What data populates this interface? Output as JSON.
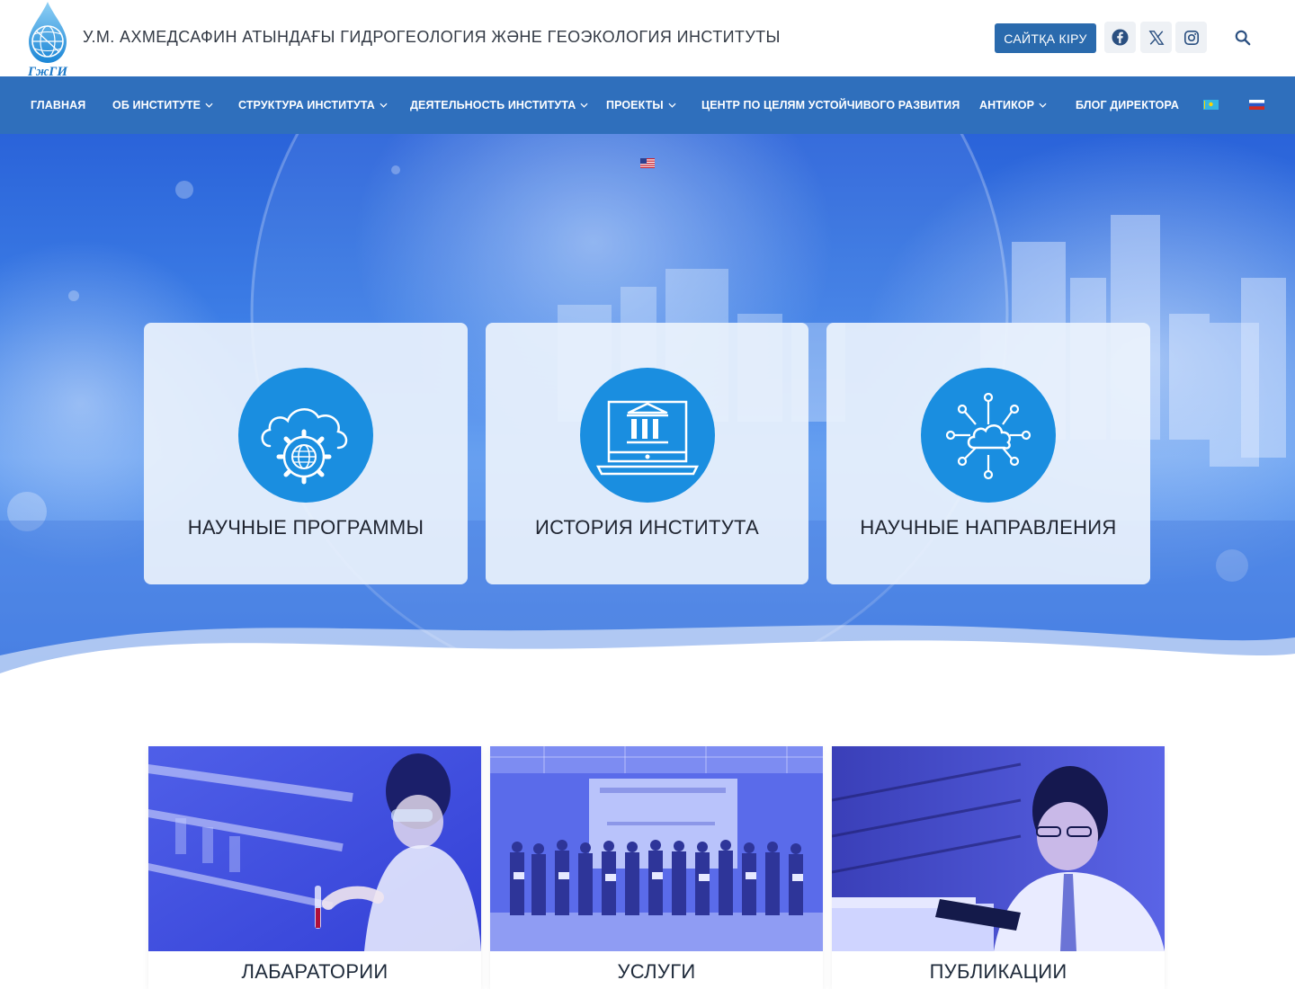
{
  "header": {
    "logo_text": "ГжГИ",
    "site_title": "У.М. АХМЕДСАФИН АТЫНДАҒЫ ГИДРОГЕОЛОГИЯ ЖӘНЕ ГЕОЭКОЛОГИЯ ИНСТИТУТЫ",
    "login_label": "САЙТҚА КІРУ",
    "social": [
      {
        "name": "facebook",
        "icon": "facebook-icon"
      },
      {
        "name": "x",
        "icon": "x-icon"
      },
      {
        "name": "instagram",
        "icon": "instagram-icon"
      }
    ],
    "search_icon": "search-icon"
  },
  "nav": {
    "items": [
      {
        "label": "ГЛАВНАЯ",
        "dropdown": false
      },
      {
        "label": "ОБ ИНСТИТУТЕ",
        "dropdown": true
      },
      {
        "label": "СТРУКТУРА ИНСТИТУТА",
        "dropdown": true
      },
      {
        "label": "ДЕЯТЕЛЬНОСТЬ ИНСТИТУТА",
        "dropdown": true
      },
      {
        "label": "ПРОЕКТЫ",
        "dropdown": true
      },
      {
        "label": "ЦЕНТР ПО ЦЕЛЯМ УСТОЙЧИВОГО РАЗВИТИЯ",
        "dropdown": false
      },
      {
        "label": "АНТИКОР",
        "dropdown": true
      },
      {
        "label": "БЛОГ ДИРЕКТОРА",
        "dropdown": false
      }
    ],
    "languages": [
      "kz-flag-icon",
      "ru-flag-icon",
      "us-flag-icon"
    ]
  },
  "hero": {
    "cards": [
      {
        "label": "НАУЧНЫЕ ПРОГРАММЫ",
        "icon": "cloud-gear-icon"
      },
      {
        "label": "ИСТОРИЯ ИНСТИТУТА",
        "icon": "institution-monitor-icon"
      },
      {
        "label": "НАУЧНЫЕ НАПРАВЛЕНИЯ",
        "icon": "cloud-network-icon"
      }
    ]
  },
  "tiles": [
    {
      "label": "ЛАБАРАТОРИИ",
      "image": "laboratory-photo"
    },
    {
      "label": "УСЛУГИ",
      "image": "group-photo"
    },
    {
      "label": "ПУБЛИКАЦИИ",
      "image": "reading-photo"
    }
  ],
  "colors": {
    "brand_blue": "#2f6fbc",
    "button_blue": "#2a6aad",
    "icon_circle": "#1a8ee0",
    "card_bg": "#eaf2fc"
  }
}
